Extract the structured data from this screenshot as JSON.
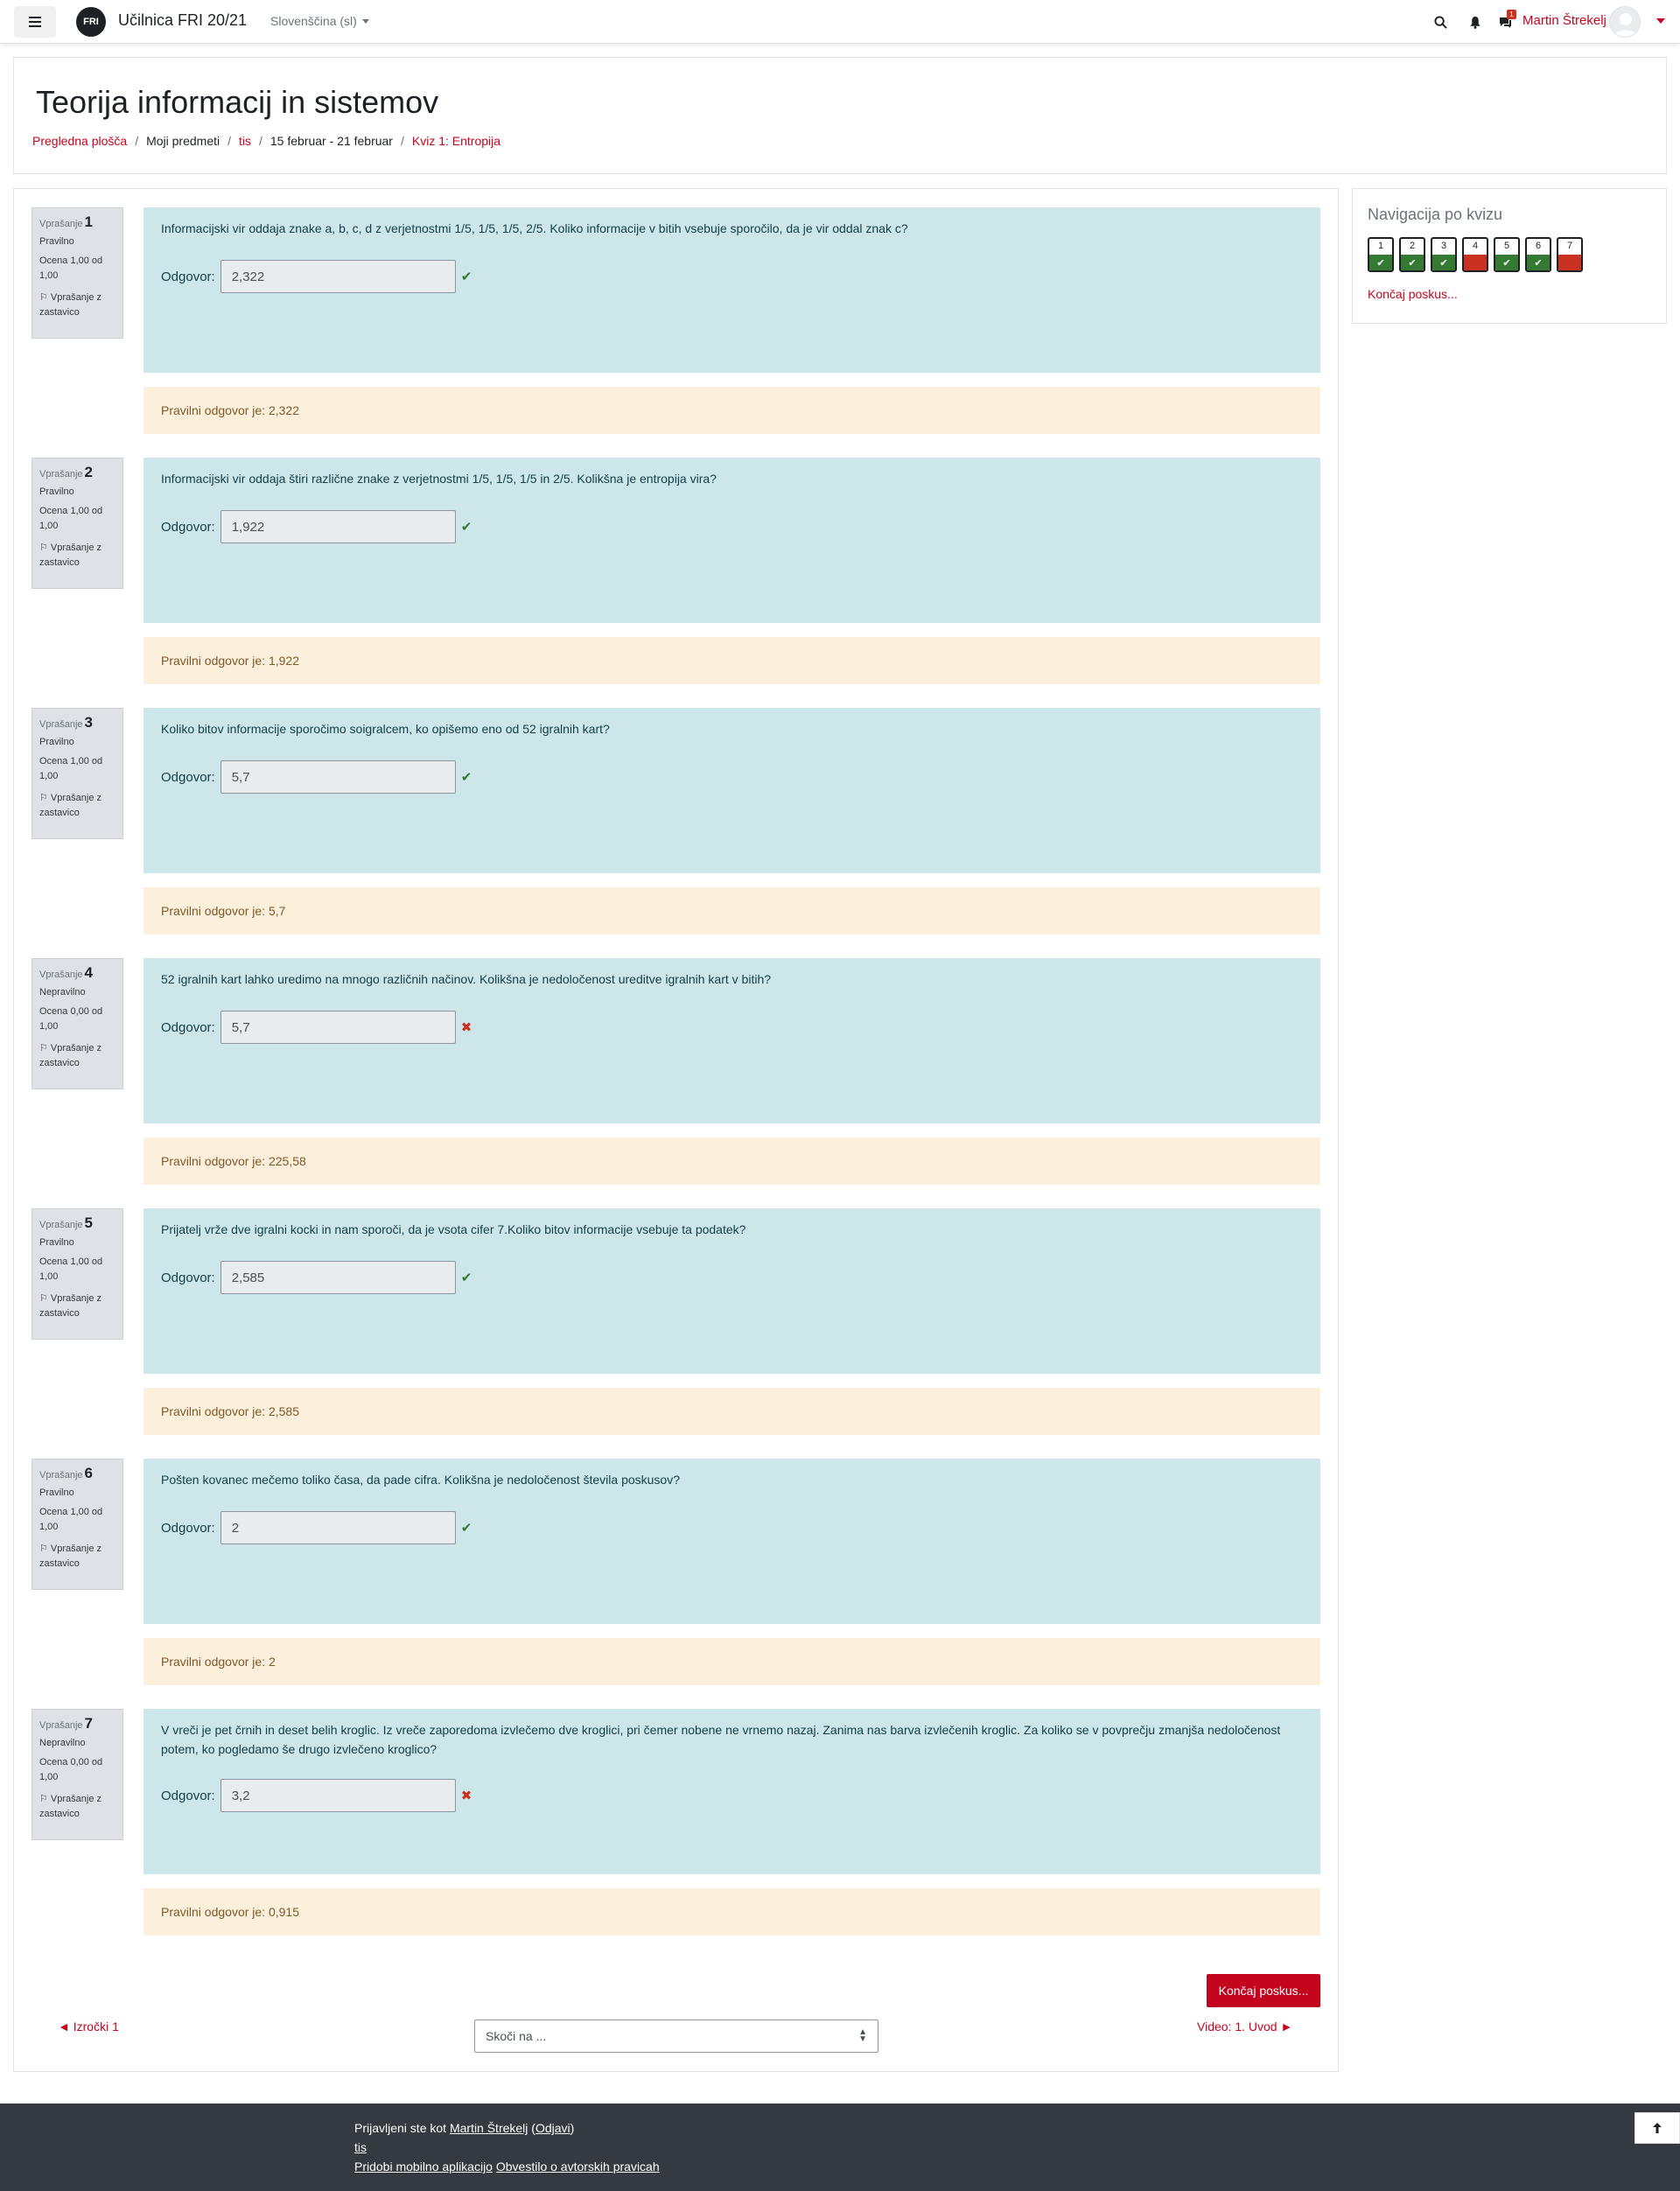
{
  "navbar": {
    "logo_text": "FRI",
    "site_name": "Učilnica FRI 20/21",
    "language": "Slovenščina (sl)",
    "message_count": "1",
    "user_name": "Martin Štrekelj"
  },
  "header": {
    "title": "Teorija informacij in sistemov",
    "breadcrumb": [
      {
        "label": "Pregledna plošča",
        "link": true
      },
      {
        "label": "Moji predmeti",
        "link": false
      },
      {
        "label": "tis",
        "link": true
      },
      {
        "label": "15 februar - 21 februar",
        "link": false
      },
      {
        "label": "Kviz 1: Entropija",
        "link": true
      }
    ]
  },
  "labels": {
    "question_prefix": "Vprašanje",
    "answer_label": "Odgovor:",
    "flag_label": "Vprašanje z zastavico",
    "feedback_prefix": "Pravilni odgovor je:"
  },
  "questions": [
    {
      "no": "1",
      "state": "Pravilno",
      "grade": "Ocena 1,00 od 1,00",
      "text": "Informacijski vir oddaja znake a, b, c, d z verjetnostmi 1/5, 1/5, 1/5, 2/5. Koliko informacije v bitih vsebuje sporočilo, da je vir oddal znak c?",
      "answer": "2,322",
      "correct": true,
      "right_answer": "Pravilni odgovor je: 2,322"
    },
    {
      "no": "2",
      "state": "Pravilno",
      "grade": "Ocena 1,00 od 1,00",
      "text": "Informacijski vir oddaja štiri različne znake z verjetnostmi 1/5, 1/5, 1/5 in 2/5. Kolikšna je entropija vira?",
      "answer": "1,922",
      "correct": true,
      "right_answer": "Pravilni odgovor je: 1,922"
    },
    {
      "no": "3",
      "state": "Pravilno",
      "grade": "Ocena 1,00 od 1,00",
      "text": "Koliko bitov informacije sporočimo soigralcem, ko opišemo eno od 52 igralnih kart?",
      "answer": "5,7",
      "correct": true,
      "right_answer": "Pravilni odgovor je: 5,7"
    },
    {
      "no": "4",
      "state": "Nepravilno",
      "grade": "Ocena 0,00 od 1,00",
      "text": "52 igralnih kart lahko uredimo na mnogo različnih načinov. Kolikšna je nedoločenost ureditve igralnih kart v bitih?",
      "answer": "5,7",
      "correct": false,
      "right_answer": "Pravilni odgovor je: 225,58"
    },
    {
      "no": "5",
      "state": "Pravilno",
      "grade": "Ocena 1,00 od 1,00",
      "text": "Prijatelj vrže dve igralni kocki in nam sporoči, da je vsota cifer 7.Koliko bitov informacije vsebuje ta podatek?",
      "answer": "2,585",
      "correct": true,
      "right_answer": "Pravilni odgovor je: 2,585"
    },
    {
      "no": "6",
      "state": "Pravilno",
      "grade": "Ocena 1,00 od 1,00",
      "text": "Pošten kovanec mečemo toliko časa, da pade cifra. Kolikšna je nedoločenost števila poskusov?",
      "answer": "2",
      "correct": true,
      "right_answer": "Pravilni odgovor je: 2"
    },
    {
      "no": "7",
      "state": "Nepravilno",
      "grade": "Ocena 0,00 od 1,00",
      "text": "V vreči je pet črnih in deset belih kroglic. Iz vreče zaporedoma izvlečemo dve kroglici, pri čemer nobene ne vrnemo nazaj. Zanima nas barva izvlečenih kroglic. Za koliko se v povprečju zmanjša nedoločenost potem, ko pogledamo še drugo izvlečeno kroglico?",
      "answer": "3,2",
      "correct": false,
      "right_answer": "Pravilni odgovor je: 0,915"
    }
  ],
  "bottom": {
    "finish_button": "Končaj poskus...",
    "prev_link": "◄ Izročki 1",
    "jump_placeholder": "Skoči na ...",
    "next_link": "Video: 1. Uvod ►"
  },
  "quiz_nav": {
    "title": "Navigacija po kvizu",
    "buttons": [
      {
        "no": "1",
        "correct": true
      },
      {
        "no": "2",
        "correct": true
      },
      {
        "no": "3",
        "correct": true
      },
      {
        "no": "4",
        "correct": false
      },
      {
        "no": "5",
        "correct": true
      },
      {
        "no": "6",
        "correct": true
      },
      {
        "no": "7",
        "correct": false
      }
    ],
    "finish_link": "Končaj poskus..."
  },
  "footer": {
    "logged_in_prefix": "Prijavljeni ste kot",
    "user": "Martin Štrekelj",
    "logout": "Odjavi",
    "course": "tis",
    "mobile_app": "Pridobi mobilno aplikacijo",
    "copyright": "Obvestilo o avtorskih pravicah"
  },
  "colors": {
    "brand": "#c4051e",
    "question_bg": "#cce6ea",
    "feedback_bg": "#fcefdc",
    "correct": "#357a32",
    "incorrect": "#ca3120"
  }
}
